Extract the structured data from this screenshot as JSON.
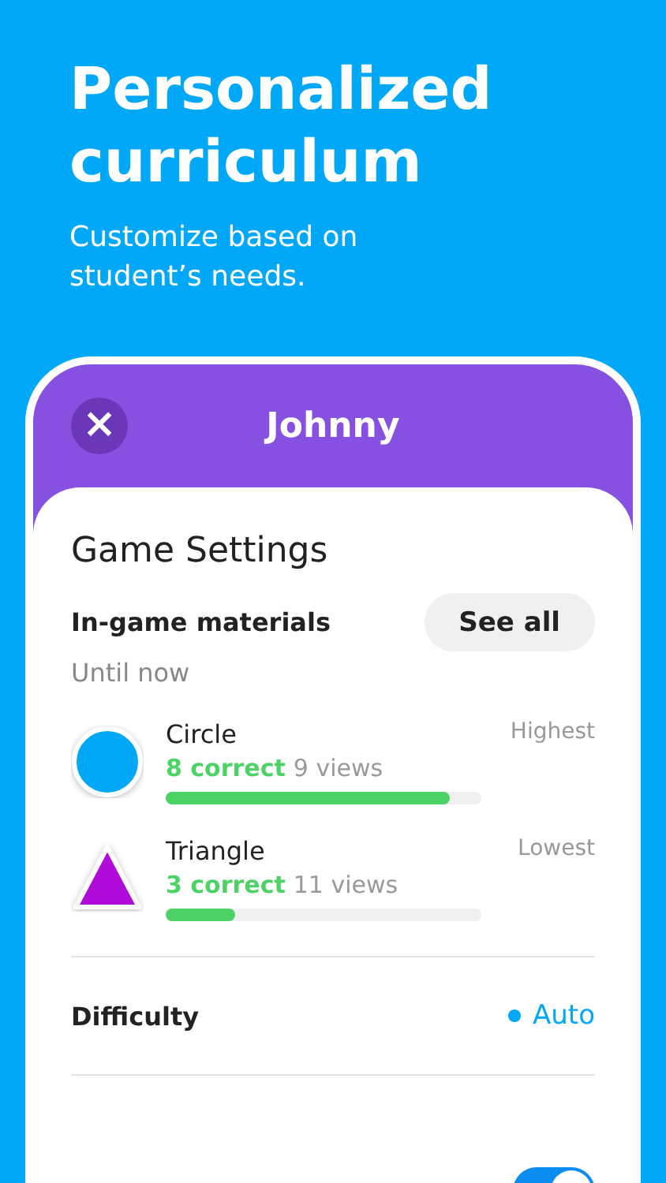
{
  "headline": "Personalized curriculum",
  "subtitle": "Customize based on student’s needs.",
  "header": {
    "close": "×",
    "title": "Johnny"
  },
  "settings": {
    "title": "Game Settings",
    "materials": {
      "label": "In-game materials",
      "button": "See all",
      "period": "Until now",
      "items": [
        {
          "kind": "circle",
          "name": "Circle",
          "correct": "8 correct",
          "views": "9 views",
          "rank": "Highest",
          "level": 0.9
        },
        {
          "kind": "triangle",
          "name": "Triangle",
          "correct": "3 correct",
          "views": "11 views",
          "rank": "Lowest",
          "level": 0.22
        }
      ]
    },
    "difficulty": {
      "label": "Difficulty",
      "value": "Auto"
    },
    "toggle": {
      "on": true
    }
  }
}
